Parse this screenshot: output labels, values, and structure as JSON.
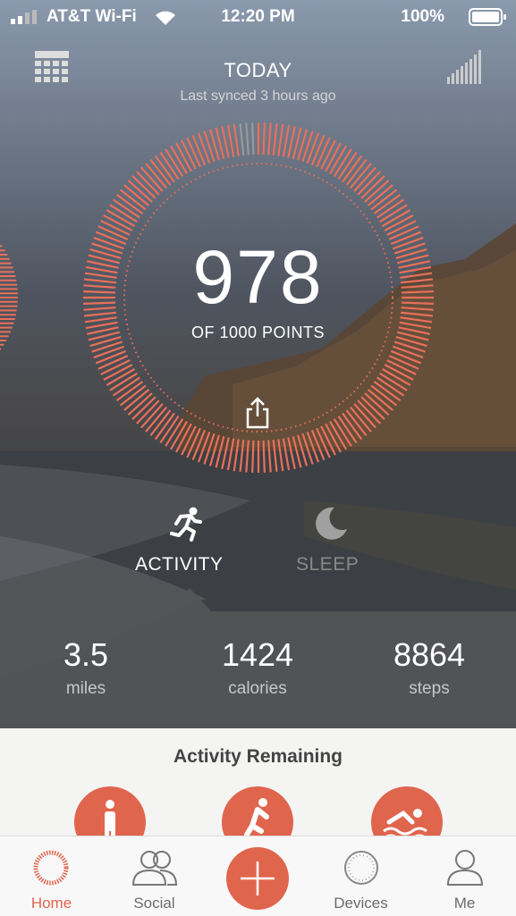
{
  "status_bar": {
    "carrier": "AT&T Wi-Fi",
    "time": "12:20 PM",
    "battery": "100%"
  },
  "header": {
    "title": "TODAY",
    "subtitle": "Last synced 3 hours ago"
  },
  "score": {
    "points": "978",
    "goal_text": "OF 1000 POINTS",
    "progress": 0.978
  },
  "tabs": [
    {
      "label": "ACTIVITY",
      "active": true
    },
    {
      "label": "SLEEP",
      "active": false
    }
  ],
  "stats": [
    {
      "value": "3.5",
      "unit": "miles"
    },
    {
      "value": "1424",
      "unit": "calories"
    },
    {
      "value": "8864",
      "unit": "steps"
    }
  ],
  "activity_remaining": {
    "title": "Activity Remaining",
    "items": [
      {
        "icon": "walking-person-icon"
      },
      {
        "icon": "running-person-icon"
      },
      {
        "icon": "swimming-person-icon"
      }
    ]
  },
  "nav": [
    {
      "label": "Home",
      "icon": "home-ring-icon",
      "active": true
    },
    {
      "label": "Social",
      "icon": "people-icon",
      "active": false
    },
    {
      "label": "",
      "icon": "plus-icon",
      "active": false
    },
    {
      "label": "Devices",
      "icon": "device-ring-icon",
      "active": false
    },
    {
      "label": "Me",
      "icon": "person-icon",
      "active": false
    }
  ],
  "colors": {
    "accent": "#e0654d",
    "ring": "#e8705a"
  }
}
